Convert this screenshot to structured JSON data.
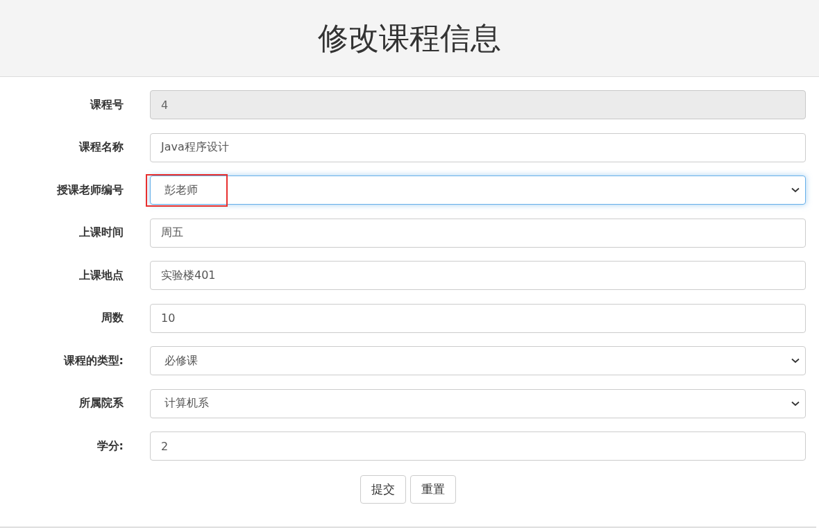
{
  "header": {
    "title": "修改课程信息"
  },
  "fields": [
    {
      "label": "课程号",
      "kind": "text",
      "value": "4",
      "disabled": true,
      "focused": false,
      "highlighted": false
    },
    {
      "label": "课程名称",
      "kind": "text",
      "value": "Java程序设计",
      "disabled": false,
      "focused": false,
      "highlighted": false
    },
    {
      "label": "授课老师编号",
      "kind": "select",
      "value": "彭老师",
      "disabled": false,
      "focused": true,
      "highlighted": true
    },
    {
      "label": "上课时间",
      "kind": "text",
      "value": "周五",
      "disabled": false,
      "focused": false,
      "highlighted": false
    },
    {
      "label": "上课地点",
      "kind": "text",
      "value": "实验楼401",
      "disabled": false,
      "focused": false,
      "highlighted": false
    },
    {
      "label": "周数",
      "kind": "text",
      "value": "10",
      "disabled": false,
      "focused": false,
      "highlighted": false
    },
    {
      "label": "课程的类型:",
      "kind": "select",
      "value": "必修课",
      "disabled": false,
      "focused": false,
      "highlighted": false
    },
    {
      "label": "所属院系",
      "kind": "select",
      "value": "计算机系",
      "disabled": false,
      "focused": false,
      "highlighted": false
    },
    {
      "label": "学分:",
      "kind": "text",
      "value": "2",
      "disabled": false,
      "focused": false,
      "highlighted": false
    }
  ],
  "buttons": [
    "提交",
    "重置"
  ]
}
